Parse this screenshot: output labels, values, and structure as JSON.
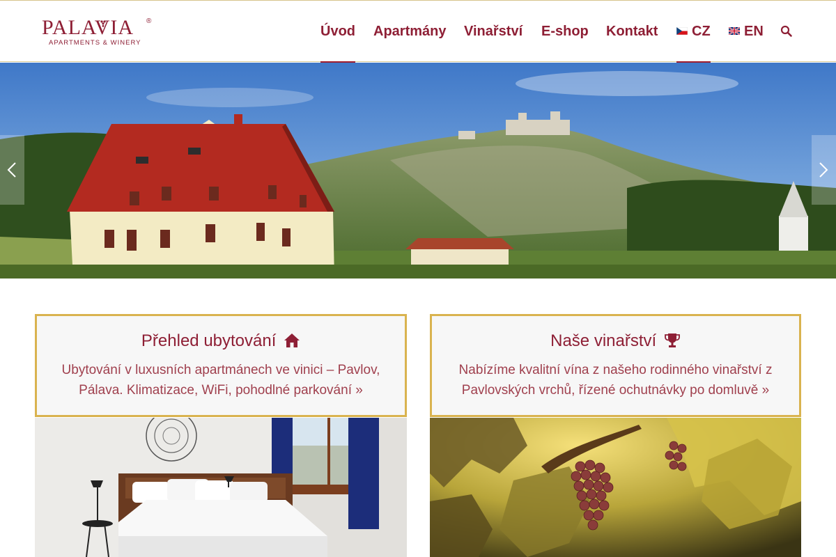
{
  "brand": {
    "name": "PALAVIA",
    "registered": "®",
    "tagline": "APARTMENTS & WINERY"
  },
  "nav": {
    "items": [
      {
        "label": "Úvod",
        "active": true
      },
      {
        "label": "Apartmány",
        "active": false
      },
      {
        "label": "Vinařství",
        "active": false
      },
      {
        "label": "E-shop",
        "active": false
      },
      {
        "label": "Kontakt",
        "active": false
      }
    ],
    "languages": [
      {
        "label": "CZ",
        "flag": "czech-flag",
        "active": true
      },
      {
        "label": "EN",
        "flag": "uk-flag",
        "active": false
      }
    ],
    "search_icon": "search-icon"
  },
  "slider": {
    "prev_icon": "chevron-left-icon",
    "next_icon": "chevron-right-icon"
  },
  "cards": [
    {
      "title": "Přehled ubytování",
      "icon": "home-icon",
      "text": "Ubytování v luxusních apartmánech ve vinici – Pavlov, Pálava. Klimatizace, WiFi, pohodlné parkování »"
    },
    {
      "title": "Naše vinařství",
      "icon": "trophy-icon",
      "text": "Nabízíme kvalitní vína z našeho rodinného vinařství z Pavlovských vrchů, řízené ochutnávky po domluvě »"
    }
  ],
  "colors": {
    "brand": "#8e1f35",
    "card_border": "#d9b34f",
    "card_text": "#a0404e"
  }
}
